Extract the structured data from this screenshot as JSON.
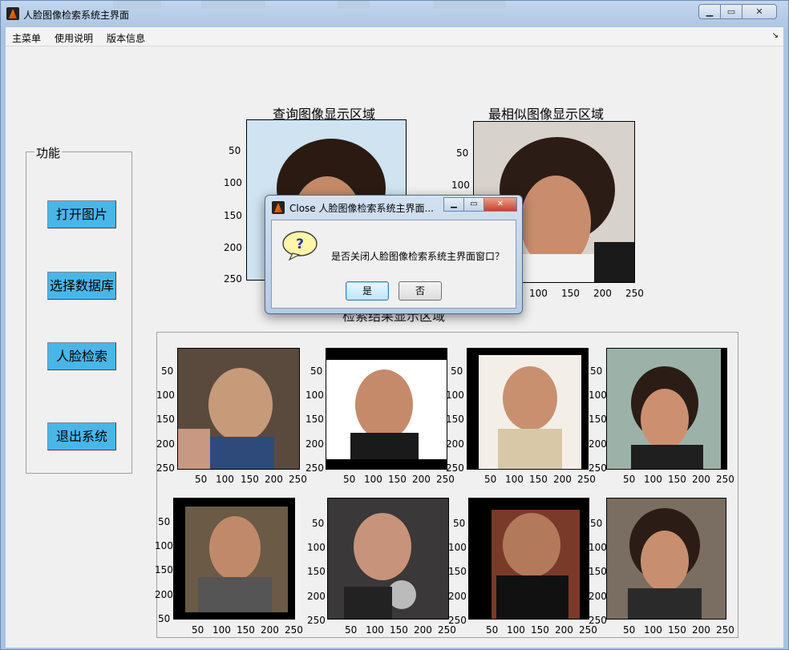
{
  "window": {
    "title": "人脸图像检索系统主界面",
    "controls": [
      "minimize",
      "maximize",
      "close"
    ]
  },
  "menubar": {
    "items": [
      {
        "label": "主菜单"
      },
      {
        "label": "使用说明"
      },
      {
        "label": "版本信息"
      }
    ]
  },
  "function_panel": {
    "title": "功能",
    "buttons": [
      {
        "label": "打开图片"
      },
      {
        "label": "选择数据库"
      },
      {
        "label": "人脸检索"
      },
      {
        "label": "退出系统"
      }
    ]
  },
  "query_axes": {
    "title": "查询图像显示区域",
    "y_ticks": [
      "50",
      "100",
      "150",
      "200",
      "250"
    ]
  },
  "best_axes": {
    "title": "最相似图像显示区域",
    "y_ticks": [
      "50",
      "100",
      "150",
      "200",
      "250"
    ],
    "x_ticks": [
      "100",
      "150",
      "200",
      "250"
    ]
  },
  "results": {
    "title": "检索结果显示区域",
    "row1": [
      {
        "y_ticks": [
          "50",
          "100",
          "150",
          "200",
          "250"
        ],
        "x_ticks": [
          "50",
          "100",
          "150",
          "200",
          "250"
        ]
      },
      {
        "y_ticks": [
          "50",
          "100",
          "150",
          "200",
          "250"
        ],
        "x_ticks": [
          "50",
          "100",
          "150",
          "200",
          "250"
        ]
      },
      {
        "y_ticks": [
          "50",
          "100",
          "150",
          "200",
          "250"
        ],
        "x_ticks": [
          "50",
          "100",
          "150",
          "200",
          "250"
        ]
      },
      {
        "y_ticks": [
          "50",
          "100",
          "150",
          "200",
          "250"
        ],
        "x_ticks": [
          "50",
          "100",
          "150",
          "200",
          "250"
        ]
      }
    ],
    "row2": [
      {
        "y_ticks": [
          "50",
          "100",
          "150",
          "200",
          "50"
        ],
        "x_ticks": [
          "50",
          "100",
          "150",
          "200",
          "250"
        ]
      },
      {
        "y_ticks": [
          "50",
          "100",
          "150",
          "200",
          "250"
        ],
        "x_ticks": [
          "50",
          "100",
          "150",
          "200",
          "250"
        ]
      },
      {
        "y_ticks": [
          "50",
          "100",
          "150",
          "200",
          "250"
        ],
        "x_ticks": [
          "50",
          "100",
          "150",
          "200",
          "250"
        ]
      },
      {
        "y_ticks": [
          "50",
          "100",
          "150",
          "200",
          "250"
        ],
        "x_ticks": [
          "50",
          "100",
          "150",
          "200",
          "250"
        ]
      }
    ]
  },
  "dialog": {
    "title": "Close 人脸图像检索系统主界面...",
    "message": "是否关闭人脸图像检索系统主界面窗口？",
    "yes_label": "是",
    "no_label": "否",
    "icon": "question-icon"
  }
}
